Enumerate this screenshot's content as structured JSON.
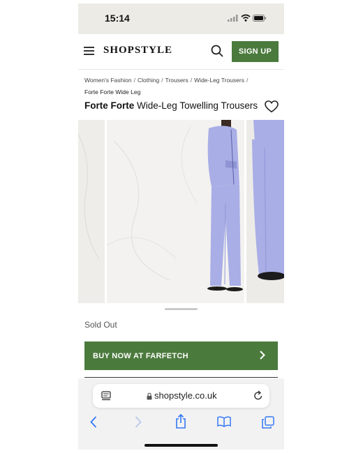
{
  "status_bar": {
    "time": "15:14"
  },
  "header": {
    "logo": "SHOPSTYLE",
    "signup_label": "SIGN UP"
  },
  "breadcrumbs": {
    "items": [
      "Women's Fashion",
      "Clothing",
      "Trousers",
      "Wide-Leg Trousers"
    ],
    "current": "Forte Forte Wide Leg"
  },
  "product": {
    "brand": "Forte Forte",
    "name": "Wide-Leg Towelling Trousers",
    "status": "Sold Out",
    "buy_label": "BUY NOW AT FARFETCH"
  },
  "browser": {
    "url": "shopstyle.co.uk"
  },
  "colors": {
    "accent": "#4b7a3d",
    "garment": "#a9aee6"
  },
  "icons": [
    "menu-icon",
    "search-icon",
    "heart-icon",
    "chevron-right-icon",
    "reader-icon",
    "lock-icon",
    "reload-icon",
    "back-icon",
    "forward-icon",
    "share-icon",
    "bookmarks-icon",
    "tabs-icon"
  ]
}
